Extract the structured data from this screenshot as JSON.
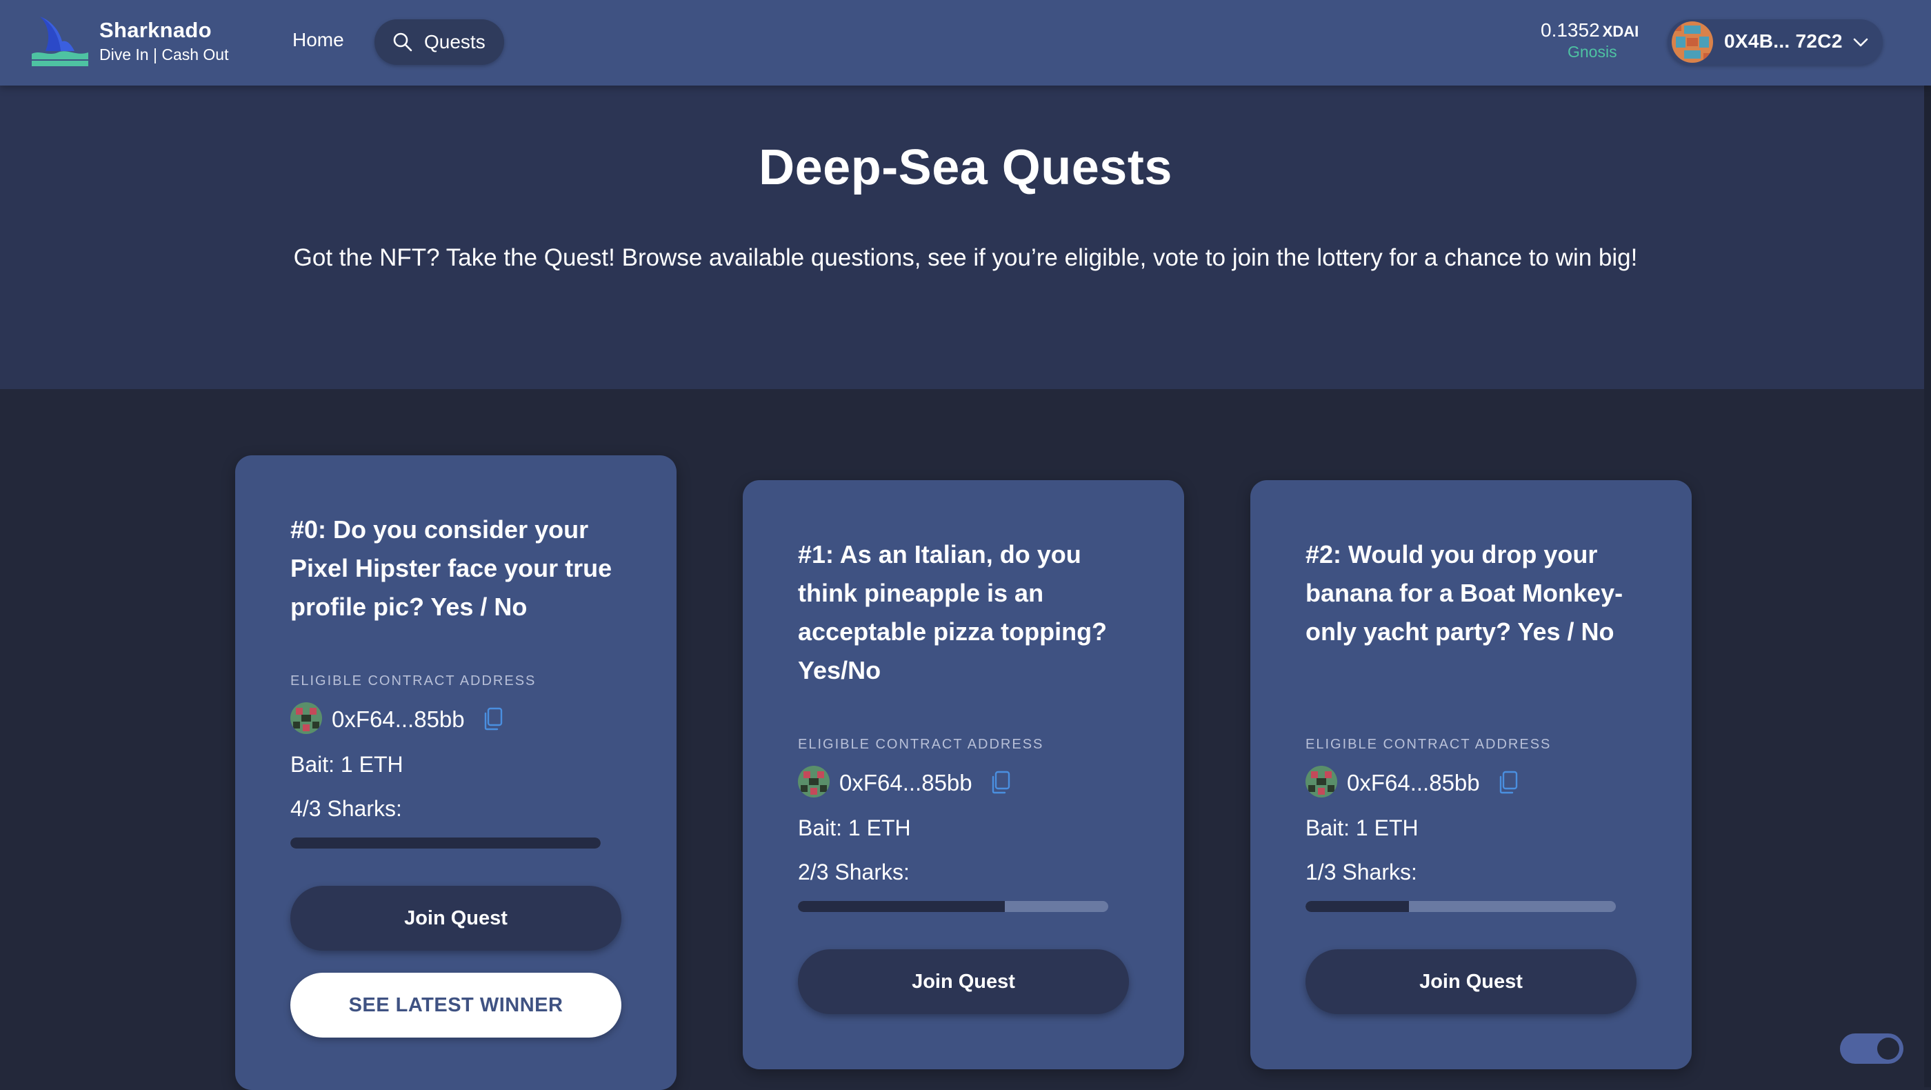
{
  "header": {
    "brand_name": "Sharknado",
    "brand_tagline": "Dive In | Cash Out",
    "nav": {
      "home_label": "Home",
      "quests_label": "Quests"
    },
    "balance": {
      "amount": "0.1352",
      "unit": "XDAI",
      "network": "Gnosis"
    },
    "wallet": {
      "address": "0X4B... 72C2"
    }
  },
  "hero": {
    "title": "Deep-Sea Quests",
    "subtitle": "Got the NFT? Take the Quest! Browse available questions, see if you’re eligible, vote to join the lottery for a chance to win big!"
  },
  "quests": [
    {
      "title": "#0: Do you consider your Pixel Hipster face your true profile pic? Yes / No",
      "eligible_label": "ELIGIBLE CONTRACT ADDRESS",
      "contract_address": "0xF64...85bb",
      "bait": "Bait: 1 ETH",
      "sharks": "4/3 Sharks:",
      "progress": 1.0,
      "join_label": "Join Quest",
      "winner_label": "SEE LATEST WINNER"
    },
    {
      "title": "#1: As an Italian, do you think pineapple is an acceptable pizza topping? Yes/No",
      "eligible_label": "ELIGIBLE CONTRACT ADDRESS",
      "contract_address": "0xF64...85bb",
      "bait": "Bait: 1 ETH",
      "sharks": "2/3 Sharks:",
      "progress": 0.667,
      "join_label": "Join Quest"
    },
    {
      "title": "#2: Would you drop your banana for a Boat Monkey-only yacht party? Yes / No",
      "eligible_label": "ELIGIBLE CONTRACT ADDRESS",
      "contract_address": "0xF64...85bb",
      "bait": "Bait: 1 ETH",
      "sharks": "1/3 Sharks:",
      "progress": 0.333,
      "join_label": "Join Quest"
    }
  ],
  "icons": {
    "logo": "shark-fin-logo",
    "search": "search-icon",
    "chevron": "chevron-down-icon",
    "copy": "copy-icon"
  },
  "colors": {
    "header_bg": "#3f5282",
    "hero_bg": "#2c3554",
    "page_bg": "#23283a",
    "card_bg": "#3f5282",
    "accent_green": "#4ec3a2",
    "copy_blue": "#4a8fe0"
  }
}
